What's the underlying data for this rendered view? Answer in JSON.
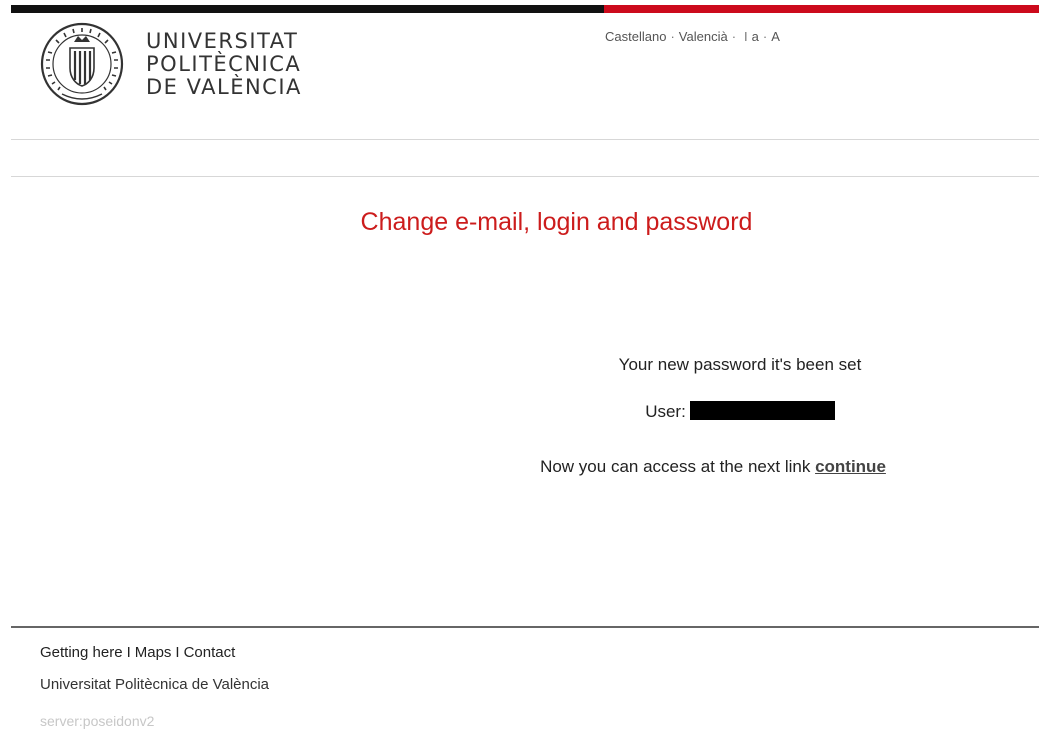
{
  "header": {
    "logo": {
      "line1": "UNIVERSITAT",
      "line2": "POLITÈCNICA",
      "line3": "DE VALÈNCIA",
      "seal_text_top": "UNIVERSITAS POLYTECHNICA",
      "seal_text_bottom": "VALENTIAE"
    },
    "languages": {
      "castellano": "Castellano",
      "valencia": "Valencià",
      "font_small": "a",
      "font_large": "A",
      "separator": "·",
      "divider": "I"
    },
    "colors": {
      "bar_dark": "#111111",
      "bar_red": "#cc0a1c"
    }
  },
  "main": {
    "title": "Change e-mail, login and password",
    "message": "Your new password it's been set",
    "user_label": "User:",
    "access_text": "Now you can access at the next link",
    "continue_link": "continue",
    "title_color": "#cc1c1c"
  },
  "footer": {
    "links": [
      "Getting here",
      "Maps",
      "Contact"
    ],
    "link_separator": "I",
    "university": "Universitat Politècnica de València",
    "server": "server:poseidonv2"
  }
}
